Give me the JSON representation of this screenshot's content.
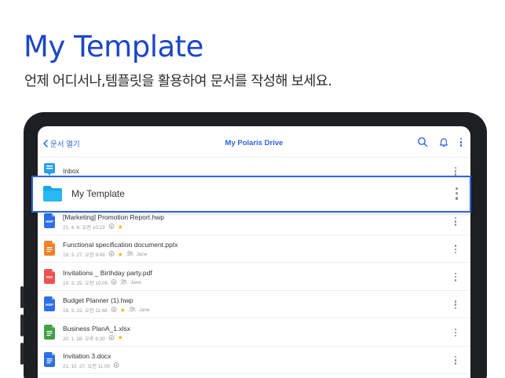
{
  "promo": {
    "headline": "My Template",
    "subline": "언제 어디서나,템플릿을 활용하여 문서를 작성해 보세요."
  },
  "topbar": {
    "back_label": "문서 열기",
    "title": "My Polaris Drive",
    "icons": [
      "search-icon",
      "bell-icon",
      "more-vertical-icon"
    ]
  },
  "inbox": {
    "label": "Inbox",
    "icon": "inbox-icon"
  },
  "highlight": {
    "label": "My Template",
    "icon": "folder-icon"
  },
  "files": [
    {
      "name": "[Marketing] Promotion Report.hwp",
      "date": "21. 4. 6. 오전 10:23",
      "type": "HWP",
      "color": "#2f6fe4",
      "starred": true,
      "shared": false,
      "owner": ""
    },
    {
      "name": "Functional specification document.pptx",
      "date": "19. 3. 27. 오전 9:49",
      "type": "PPT",
      "color": "#f0812a",
      "starred": true,
      "shared": true,
      "owner": "Jane"
    },
    {
      "name": "Invitations _ Birthday party.pdf",
      "date": "19. 3. 25. 오전 10:05",
      "type": "PDF",
      "color": "#ef5350",
      "starred": false,
      "shared": true,
      "owner": "Jane"
    },
    {
      "name": "Budget Planner (1).hwp",
      "date": "19. 3. 22. 오전 11:48",
      "type": "HWP",
      "color": "#2f6fe4",
      "starred": true,
      "shared": true,
      "owner": "Jane"
    },
    {
      "name": "Business PlanA_1.xlsx",
      "date": "20. 1. 28. 오후 6:30",
      "type": "XLS",
      "color": "#43a047",
      "starred": true,
      "shared": false,
      "owner": ""
    },
    {
      "name": "Invitation 3.docx",
      "date": "21. 10. 27. 오전 11:00",
      "type": "DOC",
      "color": "#2f6fe4",
      "starred": false,
      "shared": false,
      "owner": ""
    }
  ]
}
